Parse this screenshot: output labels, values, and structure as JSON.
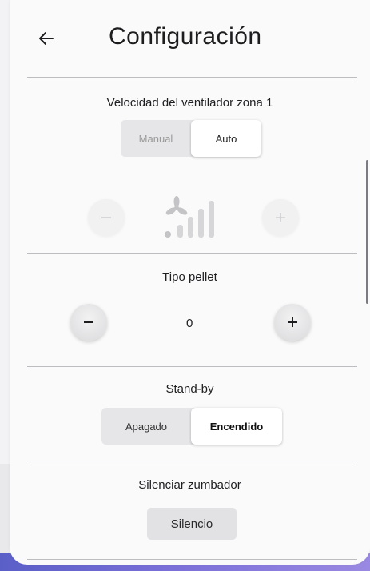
{
  "header": {
    "title": "Configuración",
    "back_icon": "arrow-left-icon"
  },
  "fan_speed": {
    "title": "Velocidad del ventilador zona 1",
    "modes": [
      {
        "label": "Manual",
        "selected": false
      },
      {
        "label": "Auto",
        "selected": true
      }
    ],
    "decrease_icon": "minus-icon",
    "increase_icon": "plus-icon",
    "level_icon": "fan-bars-icon",
    "controls_enabled": false
  },
  "pellet_type": {
    "title": "Tipo pellet",
    "value": "0",
    "decrease_icon": "minus-icon",
    "increase_icon": "plus-icon"
  },
  "standby": {
    "title": "Stand-by",
    "options": [
      {
        "label": "Apagado",
        "selected": false
      },
      {
        "label": "Encendido",
        "selected": true
      }
    ]
  },
  "buzzer": {
    "title": "Silenciar zumbador",
    "button_label": "Silencio"
  },
  "colors": {
    "accent_gradient_start": "#5a5fc7",
    "accent_gradient_end": "#9a89e2"
  }
}
